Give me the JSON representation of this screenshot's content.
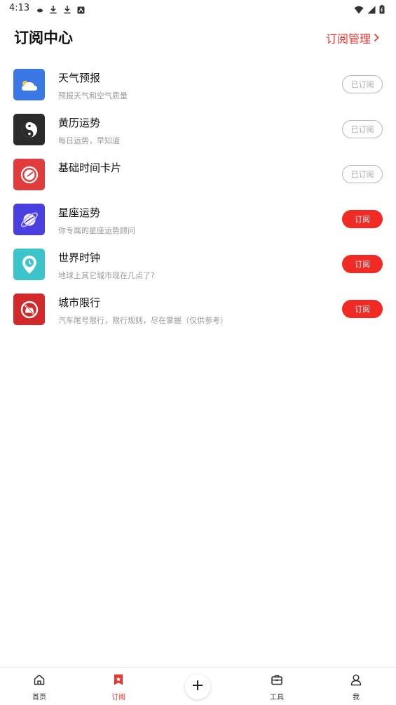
{
  "status_bar": {
    "time": "4:13"
  },
  "header": {
    "title": "订阅中心",
    "manage_label": "订阅管理"
  },
  "subscriptions": [
    {
      "title": "天气预报",
      "desc": "预报天气和空气质量",
      "status": "已订阅",
      "subscribed": true,
      "icon": "weather-icon",
      "color": "#3a78e6"
    },
    {
      "title": "黄历运势",
      "desc": "每日运势，早知道",
      "status": "已订阅",
      "subscribed": true,
      "icon": "yin-yang-icon",
      "color": "#2b2b2b"
    },
    {
      "title": "基础时间卡片",
      "desc": "",
      "status": "已订阅",
      "subscribed": true,
      "icon": "clock-icon",
      "color": "#e23b3b"
    },
    {
      "title": "星座运势",
      "desc": "你专属的星座运势顾问",
      "status": "订阅",
      "subscribed": false,
      "icon": "planet-icon",
      "color": "#4a3fe0"
    },
    {
      "title": "世界时钟",
      "desc": "地球上其它城市现在几点了?",
      "status": "订阅",
      "subscribed": false,
      "icon": "location-clock-icon",
      "color": "#3bc4c9"
    },
    {
      "title": "城市限行",
      "desc": "汽车尾号限行，限行规则，尽在掌握（仅供参考）",
      "status": "订阅",
      "subscribed": false,
      "icon": "no-car-icon",
      "color": "#d22a2a"
    }
  ],
  "bottom_nav": [
    {
      "label": "首页",
      "icon": "home-icon",
      "active": false
    },
    {
      "label": "订阅",
      "icon": "bookmark-star-icon",
      "active": true
    },
    {
      "label": "",
      "icon": "plus-icon",
      "active": false
    },
    {
      "label": "工具",
      "icon": "toolbox-icon",
      "active": false
    },
    {
      "label": "我",
      "icon": "user-icon",
      "active": false
    }
  ],
  "colors": {
    "accent": "#f0302a",
    "subscribe_button": "#f22a26",
    "muted_text": "#9a9a9a"
  }
}
